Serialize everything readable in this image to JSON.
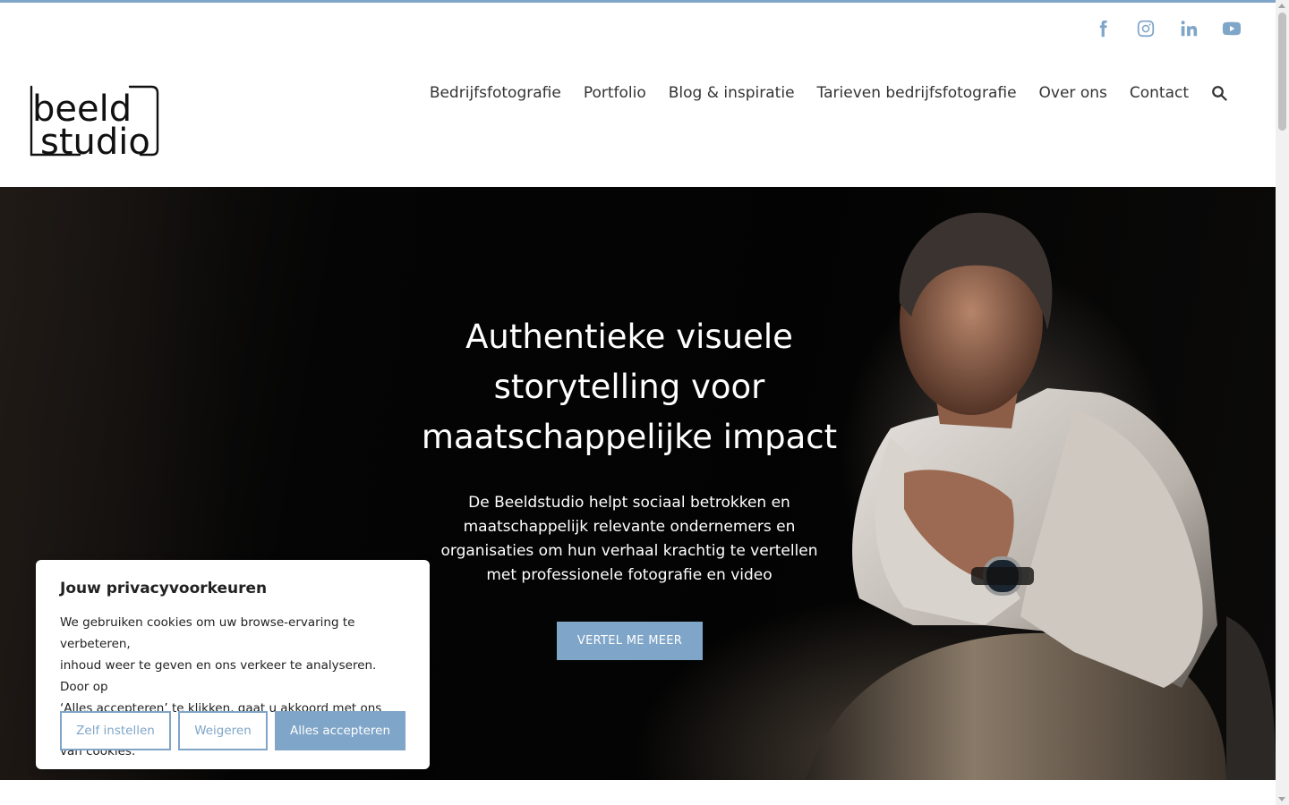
{
  "colors": {
    "accent": "#7fa5c8",
    "text": "#333333",
    "hero_bg": "#050505"
  },
  "social": [
    {
      "name": "facebook-icon"
    },
    {
      "name": "instagram-icon"
    },
    {
      "name": "linkedin-icon"
    },
    {
      "name": "youtube-icon"
    }
  ],
  "logo": {
    "line1": "beeld",
    "line2": "studio"
  },
  "nav": {
    "items": [
      "Bedrijfsfotografie",
      "Portfolio",
      "Blog & inspiratie",
      "Tarieven bedrijfsfotografie",
      "Over ons",
      "Contact"
    ],
    "search_icon": "search-icon"
  },
  "hero": {
    "title_line1": "Authentieke visuele",
    "title_line2": "storytelling voor",
    "title_line3": "maatschappelijke impact",
    "text_line1": "De Beeldstudio helpt sociaal betrokken en",
    "text_line2": "maatschappelijk relevante ondernemers en",
    "text_line3": "organisaties om hun verhaal krachtig te vertellen",
    "text_line4": "met professionele fotografie en video",
    "button": "VERTEL ME MEER"
  },
  "cookie": {
    "title": "Jouw privacyvoorkeuren",
    "line1": "We gebruiken cookies om uw browse-ervaring te verbeteren,",
    "line2": "inhoud weer te geven en ons verkeer te analyseren. Door op",
    "line3": "‘Alles accepteren’ te klikken, gaat u akkoord met ons gebruik",
    "line4": "van cookies.",
    "btn_custom": "Zelf instellen",
    "btn_reject": "Weigeren",
    "btn_accept": "Alles accepteren"
  }
}
